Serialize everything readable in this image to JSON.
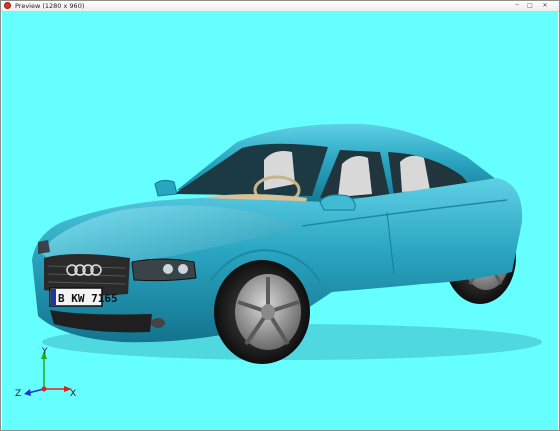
{
  "window": {
    "title": "Preview (1280 x 960)",
    "minimize_glyph": "─",
    "maximize_glyph": "□",
    "close_glyph": "✕"
  },
  "viewport": {
    "background": "#66ffff",
    "car": {
      "body_color": "#2aa5c0",
      "license_plate": "B KW 7165"
    },
    "axis_gizmo": {
      "y_label": "Y",
      "z_label": "Z",
      "x_label": "X",
      "y_color": "#22aa22",
      "z_color": "#2233cc",
      "x_color": "#dd2222"
    }
  }
}
